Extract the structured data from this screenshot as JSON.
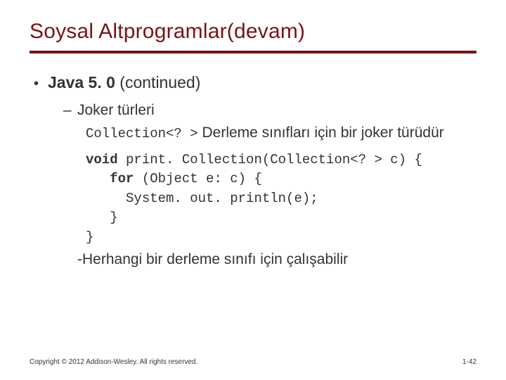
{
  "title": "Soysal Altprogramlar(devam)",
  "bullet1": {
    "strong": "Java 5. 0",
    "cont": " (continued)"
  },
  "bullet2": "Joker türleri",
  "explain": {
    "code": "Collection<? >",
    "rest": " Derleme sınıfları için bir joker türüdür"
  },
  "code": {
    "l1a": "void",
    "l1b": " print. Collection(Collection<? > c) {",
    "l2a": "for",
    "l2b": " (Object e: c) {",
    "l3": "System. out. println(e);",
    "l4": "}",
    "l5": "}"
  },
  "closing": "-Herhangi bir derleme sınıfı için çalışabilir",
  "footer": {
    "copyright": "Copyright © 2012 Addison-Wesley. All rights reserved.",
    "page": "1-42"
  }
}
